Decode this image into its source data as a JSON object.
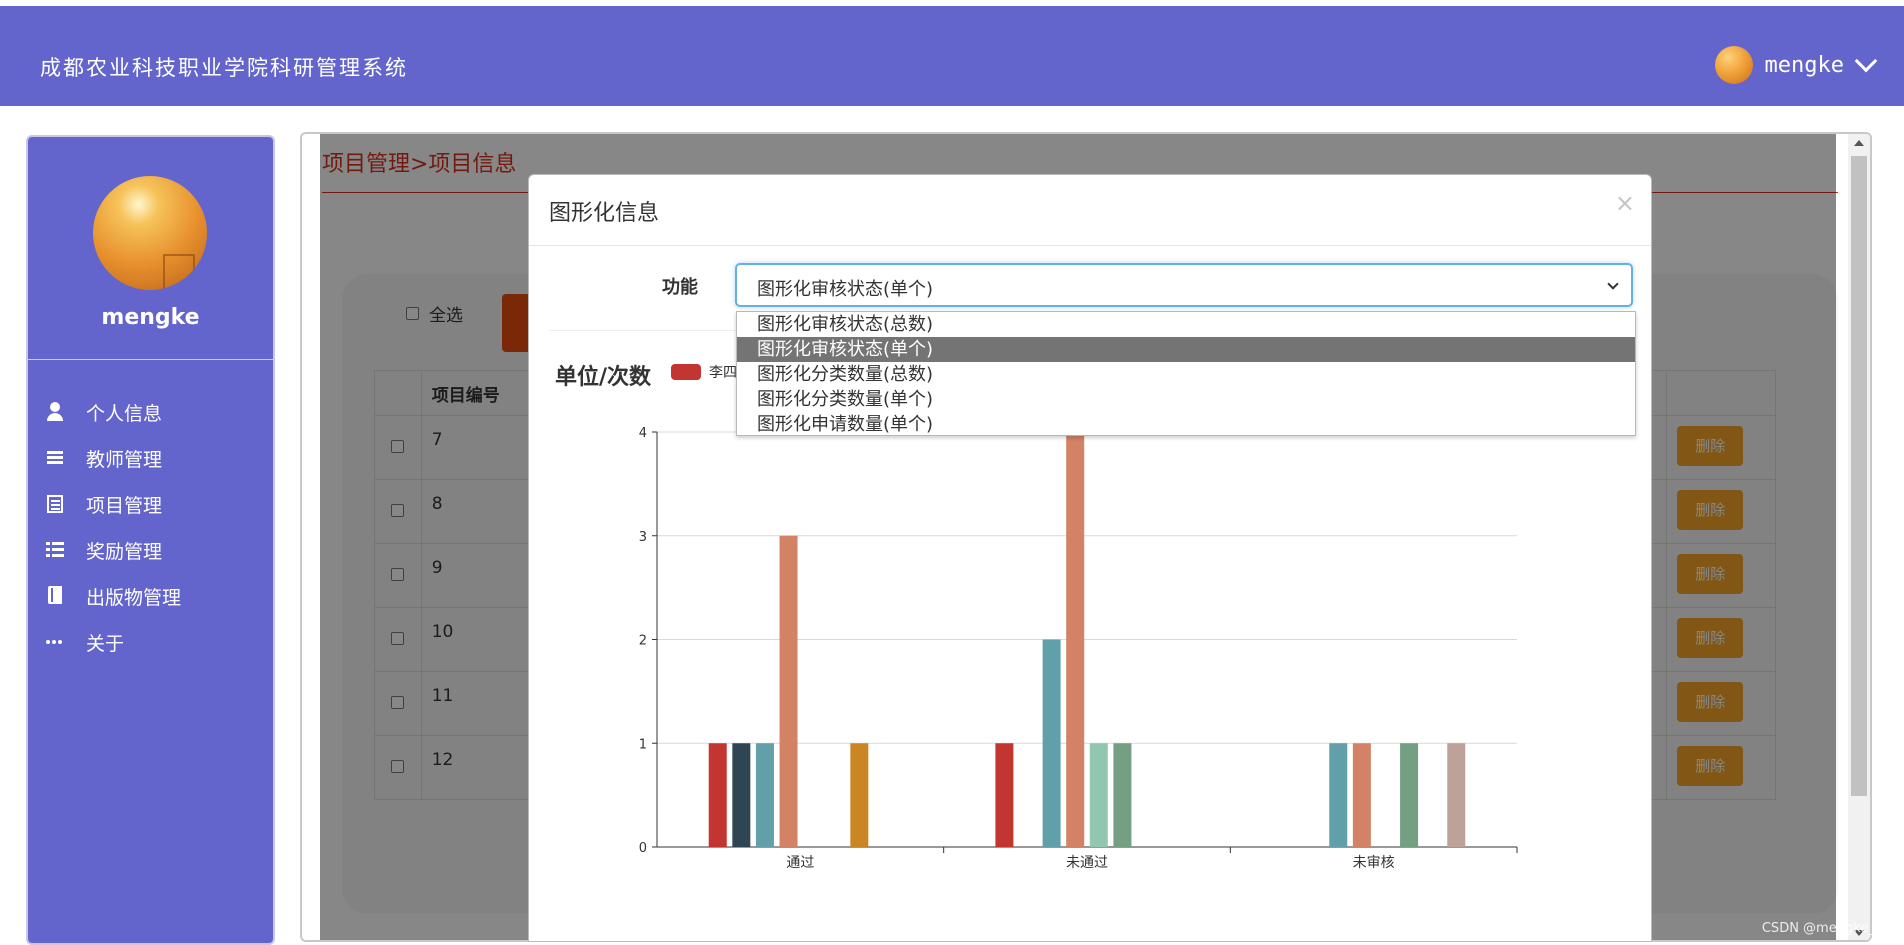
{
  "header": {
    "title": "成都农业科技职业学院科研管理系统",
    "username": "mengke"
  },
  "sidebar": {
    "username": "mengke",
    "items": [
      {
        "label": "个人信息",
        "icon": "person-icon"
      },
      {
        "label": "教师管理",
        "icon": "list-icon"
      },
      {
        "label": "项目管理",
        "icon": "document-icon"
      },
      {
        "label": "奖励管理",
        "icon": "th-list-icon"
      },
      {
        "label": "出版物管理",
        "icon": "book-icon"
      },
      {
        "label": "关于",
        "icon": "dots-icon"
      }
    ]
  },
  "main": {
    "breadcrumb": "项目管理>项目信息",
    "select_all": "全选",
    "table": {
      "header": "项目编号",
      "rows": [
        "7",
        "8",
        "9",
        "10",
        "11",
        "12"
      ],
      "delete_label": "删除"
    }
  },
  "modal": {
    "title": "图形化信息",
    "close": "×",
    "field_label": "功能",
    "selected": "图形化审核状态(单个)",
    "options": [
      "图形化审核状态(总数)",
      "图形化审核状态(单个)",
      "图形化分类数量(总数)",
      "图形化分类数量(单个)",
      "图形化申请数量(单个)"
    ],
    "highlighted_index": 1,
    "chart_heading": "单位/次数"
  },
  "chart_data": {
    "type": "bar",
    "categories": [
      "通过",
      "未通过",
      "未审核"
    ],
    "ylim": [
      0,
      4
    ],
    "yticks": [
      0,
      1,
      2,
      3,
      4
    ],
    "legend_visible": [
      "李四"
    ],
    "series": [
      {
        "name": "李四",
        "color": "#c23531",
        "values": [
          1,
          1,
          0
        ]
      },
      {
        "color": "#2f4554",
        "values": [
          1,
          0,
          0
        ]
      },
      {
        "color": "#61a0a8",
        "values": [
          1,
          2,
          1
        ]
      },
      {
        "color": "#d48265",
        "values": [
          3,
          4,
          1
        ]
      },
      {
        "color": "#91c7ae",
        "values": [
          0,
          1,
          0
        ]
      },
      {
        "color": "#749f83",
        "values": [
          0,
          1,
          1
        ]
      },
      {
        "color": "#ca8622",
        "values": [
          1,
          0,
          0
        ]
      },
      {
        "color": "#bda29a",
        "values": [
          0,
          0,
          1
        ]
      }
    ]
  },
  "watermark": "CSDN @mengke_xk"
}
